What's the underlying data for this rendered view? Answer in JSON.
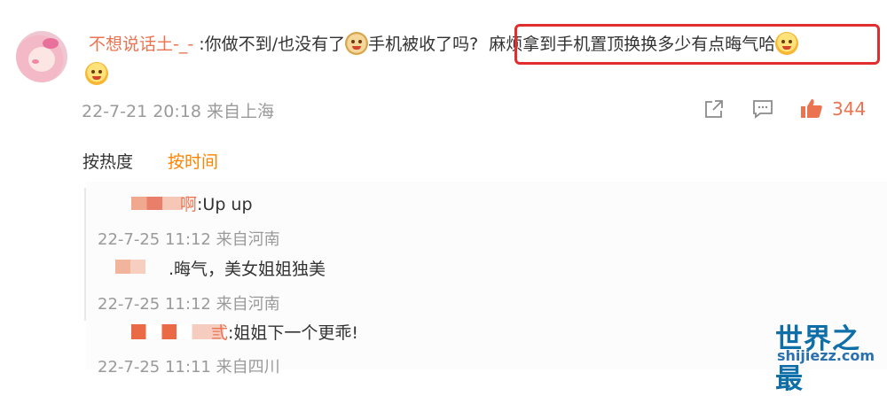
{
  "comment": {
    "username": "不想说话土-_-",
    "text_before": ":你做不到/也没有了",
    "text_middle": "手机被收了吗?",
    "highlighted_text": "麻烦拿到手机置顶换换多少有点晦气哈",
    "timestamp": "22-7-21 20:18 来自上海",
    "like_count": "344"
  },
  "sort": {
    "hot_label": "按热度",
    "time_label": "按时间"
  },
  "replies": [
    {
      "user_suffix": "啊",
      "text": ":Up up",
      "timestamp": "22-7-25 11:12 来自河南"
    },
    {
      "text": ".晦气，美女姐姐独美",
      "timestamp": "22-7-25 11:12 来自河南"
    },
    {
      "user_suffix": "弎",
      "text": ":姐姐下一个更乖!",
      "timestamp": "22-7-25 11:11 来自四川"
    }
  ],
  "watermark": {
    "title": "世界之最",
    "url": "shijiezz.com"
  },
  "colors": {
    "username": "#eb7350",
    "active_tab": "#ff8200",
    "highlight_border": "#e12d2d",
    "meta": "#9a9a9a"
  },
  "icons": [
    "share-icon",
    "comment-icon",
    "like-icon",
    "emoji-smile-icon",
    "doge-icon"
  ]
}
